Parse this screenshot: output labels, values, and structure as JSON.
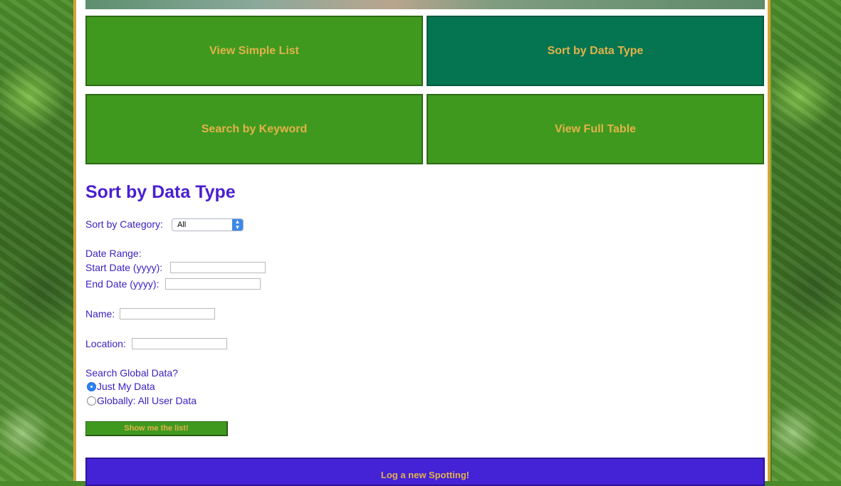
{
  "nav": {
    "view_simple_list": "View Simple List",
    "sort_by_data_type": "Sort by Data Type",
    "search_by_keyword": "Search by Keyword",
    "view_full_table": "View Full Table"
  },
  "form": {
    "heading": "Sort by Data Type",
    "category_label": "Sort by Category:",
    "category_selected": "All",
    "date_range_label": "Date Range:",
    "start_date_label": "Start Date (yyyy):",
    "end_date_label": "End Date (yyyy):",
    "name_label": "Name:",
    "location_label": "Location:",
    "global_label": "Search Global Data?",
    "radio_options": [
      "Just My Data",
      "Globally: All User Data"
    ],
    "submit_label": "Show me the list!"
  },
  "footer": {
    "log_button": "Log a new Spotting!"
  },
  "colors": {
    "nav_green": "#3f991f",
    "nav_active": "#047451",
    "accent_text": "#e3b24a",
    "heading_purple": "#4a1fd1",
    "frame_gold": "#d4a437"
  }
}
